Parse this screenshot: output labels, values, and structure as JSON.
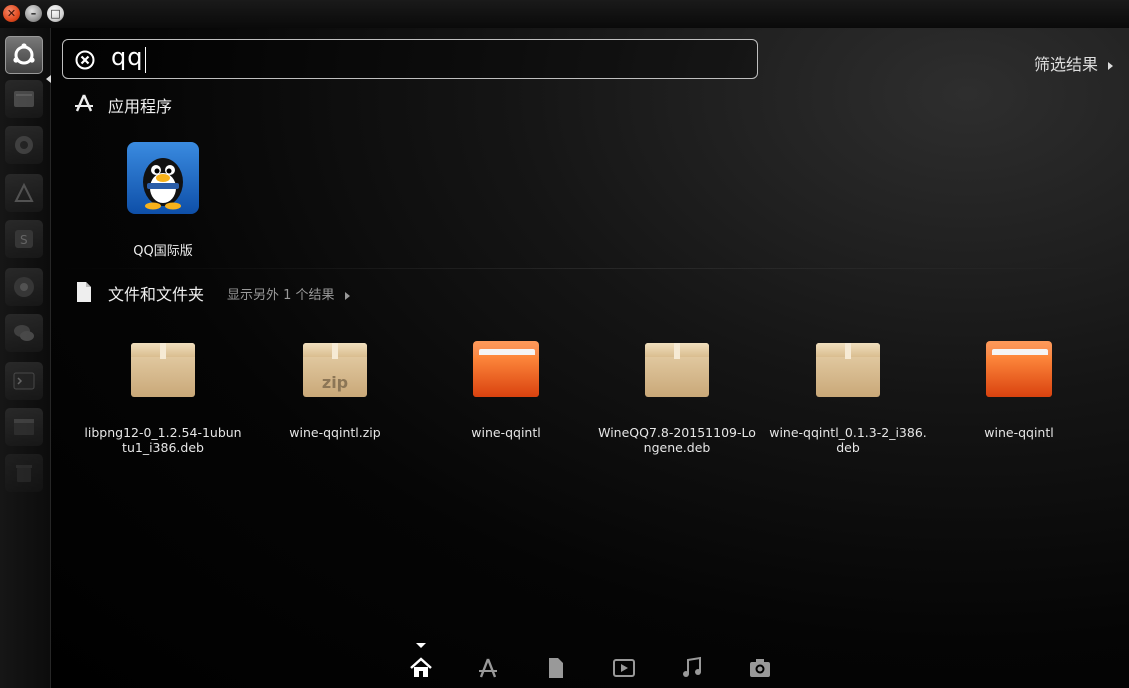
{
  "window": {
    "controls": [
      "close",
      "minimize",
      "maximize"
    ]
  },
  "search": {
    "query": "qq"
  },
  "filter": {
    "label": "筛选结果"
  },
  "categories": {
    "apps": {
      "label": "应用程序",
      "icon": "apps-lens-icon"
    },
    "files": {
      "label": "文件和文件夹",
      "more_label": "显示另外 1 个结果",
      "icon": "file-icon"
    }
  },
  "apps": [
    {
      "name": "QQ国际版",
      "icon": "qq-penguin-icon"
    }
  ],
  "files": [
    {
      "name": "libpng12-0_1.2.54-1ubuntu1_i386.deb",
      "type": "deb"
    },
    {
      "name": "wine-qqintl.zip",
      "type": "zip",
      "badge": "zip"
    },
    {
      "name": "wine-qqintl",
      "type": "folder"
    },
    {
      "name": "WineQQ7.8-20151109-Longene.deb",
      "type": "deb"
    },
    {
      "name": "wine-qqintl_0.1.3-2_i386.deb",
      "type": "deb"
    },
    {
      "name": "wine-qqintl",
      "type": "folder"
    }
  ],
  "lenses": [
    "home-lens-icon",
    "apps-lens-icon",
    "files-lens-icon",
    "video-lens-icon",
    "music-lens-icon",
    "photos-lens-icon"
  ],
  "launcher": [
    "ubuntu-dash-icon",
    "files-app-icon",
    "settings-icon",
    "editor-icon",
    "sublime-icon",
    "chrome-icon",
    "wechat-icon",
    "terminal-icon",
    "window-icon",
    "trash-icon"
  ]
}
